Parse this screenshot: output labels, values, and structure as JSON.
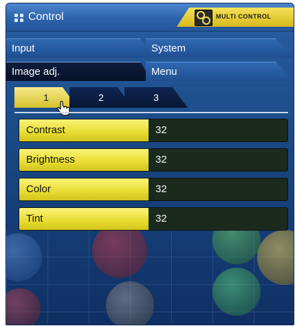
{
  "title_bar": {
    "title": "Control",
    "badge_label": "MULTI CONTROL",
    "icons": [
      "grid-dots-icon",
      "multi-control-icon"
    ]
  },
  "menu_tabs": {
    "input": "Input",
    "system": "System",
    "image_adj": "Image adj.",
    "menu": "Menu"
  },
  "sub_tabs": [
    "1",
    "2",
    "3"
  ],
  "active_sub_tab": "1",
  "settings": [
    {
      "label": "Contrast",
      "value": "32"
    },
    {
      "label": "Brightness",
      "value": "32"
    },
    {
      "label": "Color",
      "value": "32"
    },
    {
      "label": "Tint",
      "value": "32"
    }
  ],
  "colors": {
    "accent_yellow": "#e7dc2f",
    "panel_blue": "#1b4a86",
    "value_bg": "#1c2a1e"
  }
}
